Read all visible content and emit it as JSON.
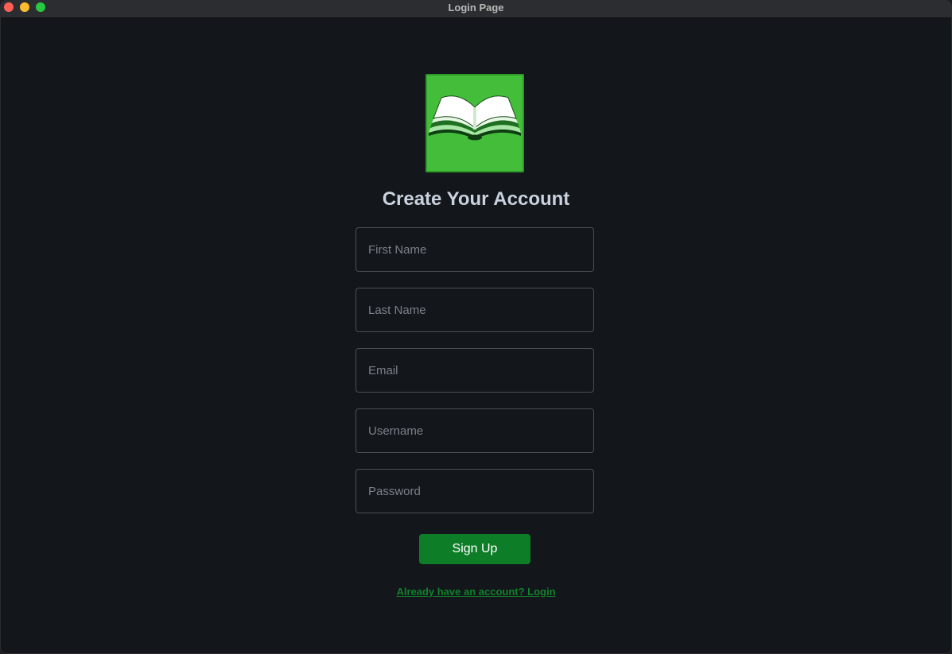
{
  "window": {
    "title": "Login Page"
  },
  "logo": {
    "icon": "open-book-icon",
    "background_color": "#43bd3a"
  },
  "form": {
    "heading": "Create Your Account",
    "fields": {
      "first_name": {
        "placeholder": "First Name",
        "value": ""
      },
      "last_name": {
        "placeholder": "Last Name",
        "value": ""
      },
      "email": {
        "placeholder": "Email",
        "value": ""
      },
      "username": {
        "placeholder": "Username",
        "value": ""
      },
      "password": {
        "placeholder": "Password",
        "value": ""
      }
    },
    "submit_label": "Sign Up",
    "login_link": "Already have an account? Login"
  },
  "colors": {
    "accent": "#0e7d28",
    "link": "#10822a",
    "background": "#13161b"
  }
}
